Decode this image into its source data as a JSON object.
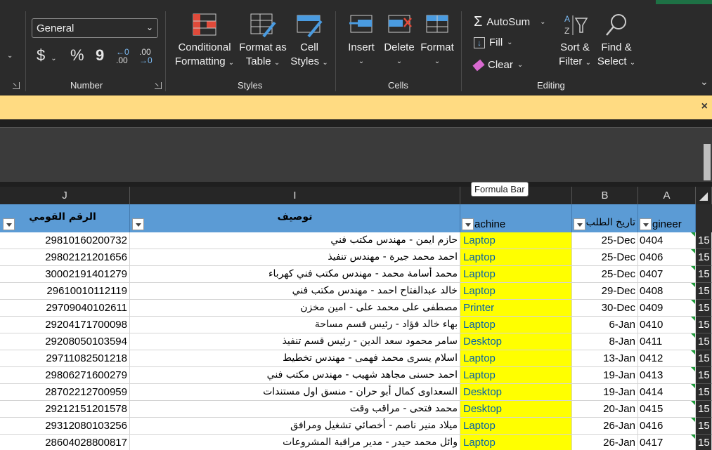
{
  "ribbon": {
    "number_format": "General",
    "number_group_label": "Number",
    "styles_group_label": "Styles",
    "cells_group_label": "Cells",
    "editing_group_label": "Editing",
    "currency_symbol": "$",
    "percent_symbol": "%",
    "comma_symbol": "9",
    "inc_decimal": ".00",
    "dec_decimal": ".00",
    "conditional_formatting": [
      "Conditional",
      "Formatting"
    ],
    "format_as_table": [
      "Format as",
      "Table"
    ],
    "cell_styles": [
      "Cell",
      "Styles"
    ],
    "insert": "Insert",
    "delete": "Delete",
    "format": "Format",
    "autosum": "AutoSum",
    "fill": "Fill",
    "clear": "Clear",
    "sort_filter": [
      "Sort &",
      "Filter"
    ],
    "find_select": [
      "Find &",
      "Select"
    ]
  },
  "tooltip": "Formula Bar",
  "columns": {
    "J": "J",
    "I": "I",
    "B": "B",
    "A": "A"
  },
  "headers": {
    "national_id": "الرقم القومي",
    "description": "توصيف",
    "machine": "achine",
    "request_date": "تاريخ الطلب",
    "engineer": "gineer"
  },
  "rows": [
    {
      "id": "29810160200732",
      "desc": "حازم ايمن - مهندس مكتب فني",
      "machine": "Laptop",
      "date": "25-Dec",
      "code": "0404",
      "rn": "15"
    },
    {
      "id": "29802121201656",
      "desc": "احمد محمد جيرة - مهندس تنفيذ",
      "machine": "Laptop",
      "date": "25-Dec",
      "code": "0406",
      "rn": "15"
    },
    {
      "id": "30002191401279",
      "desc": "محمد أسامة محمد - مهندس مكتب فني كهرباء",
      "machine": "Laptop",
      "date": "25-Dec",
      "code": "0407",
      "rn": "15"
    },
    {
      "id": "29610010112119",
      "desc": "خالد عبدالفتاح احمد - مهندس مكتب فني",
      "machine": "Laptop",
      "date": "29-Dec",
      "code": "0408",
      "rn": "15"
    },
    {
      "id": "29709040102611",
      "desc": "مصطفى على محمد على - امين مخزن",
      "machine": "Printer",
      "date": "30-Dec",
      "code": "0409",
      "rn": "15"
    },
    {
      "id": "29204171700098",
      "desc": "بهاء خالد فؤاد - رئيس قسم مساحة",
      "machine": "Laptop",
      "date": "6-Jan",
      "code": "0410",
      "rn": "15"
    },
    {
      "id": "29208050103594",
      "desc": "سامر محمود سعد الدين - رئيس قسم تنفيذ",
      "machine": "Desktop",
      "date": "8-Jan",
      "code": "0411",
      "rn": "15"
    },
    {
      "id": "29711082501218",
      "desc": "اسلام يسرى محمد فهمى - مهندس تخطيط",
      "machine": "Laptop",
      "date": "13-Jan",
      "code": "0412",
      "rn": "15"
    },
    {
      "id": "29806271600279",
      "desc": "احمد حسنى مجاهد شهيب - مهندس مكتب فني",
      "machine": "Laptop",
      "date": "19-Jan",
      "code": "0413",
      "rn": "15"
    },
    {
      "id": "28702212700959",
      "desc": "السعداوى كمال أبو حران - منسق اول مستندات",
      "machine": "Desktop",
      "date": "19-Jan",
      "code": "0414",
      "rn": "15"
    },
    {
      "id": "29212151201578",
      "desc": "محمد فتحى - مراقب وقت",
      "machine": "Desktop",
      "date": "20-Jan",
      "code": "0415",
      "rn": "15"
    },
    {
      "id": "29312080103256",
      "desc": "ميلاد منير ناصم - أخصائي تشغيل ومرافق",
      "machine": "Laptop",
      "date": "26-Jan",
      "code": "0416",
      "rn": "15"
    },
    {
      "id": "28604028800817",
      "desc": "وائل محمد حيدر - مدير مراقبة المشروعات",
      "machine": "Laptop",
      "date": "26-Jan",
      "code": "0417",
      "rn": "15"
    }
  ]
}
